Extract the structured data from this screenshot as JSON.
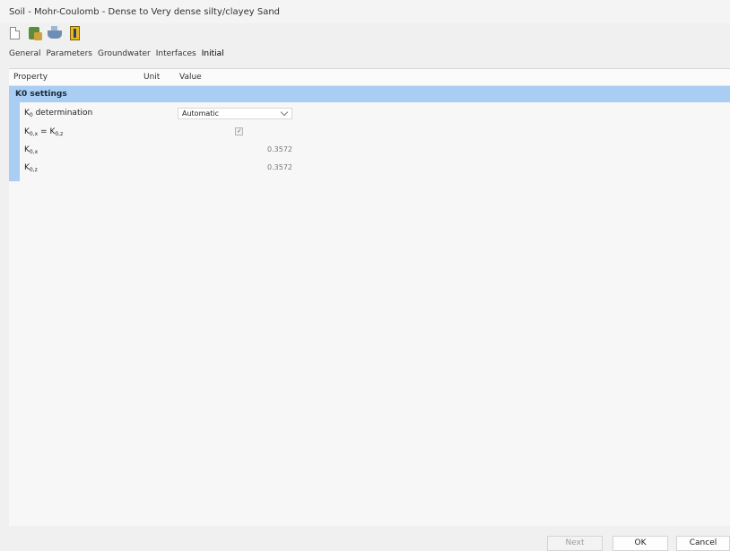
{
  "window": {
    "title": "Soil - Mohr-Coulomb - Dense to Very dense silty/clayey Sand"
  },
  "toolbar": {
    "icons": [
      "new-document-icon",
      "open-database-icon",
      "ship-icon",
      "book-icon"
    ]
  },
  "tabs": [
    "General",
    "Parameters",
    "Groundwater",
    "Interfaces",
    "Initial"
  ],
  "active_tab": "Initial",
  "grid": {
    "headers": {
      "property": "Property",
      "unit": "Unit",
      "value": "Value"
    },
    "group": "K0 settings",
    "rows": {
      "k0_determination": {
        "main": "K",
        "sub": "0",
        "rest": " determination",
        "value": "Automatic"
      },
      "k0x_equals_k0z": {
        "a_main": "K",
        "a_sub": "0,x",
        "eq": " = ",
        "b_main": "K",
        "b_sub": "0,z",
        "checked": true,
        "tick": "✓"
      },
      "k0x": {
        "main": "K",
        "sub": "0,x",
        "value": "0.3572"
      },
      "k0z": {
        "main": "K",
        "sub": "0,z",
        "value": "0.3572"
      }
    }
  },
  "footer": {
    "next": "Next",
    "ok": "OK",
    "cancel": "Cancel"
  }
}
